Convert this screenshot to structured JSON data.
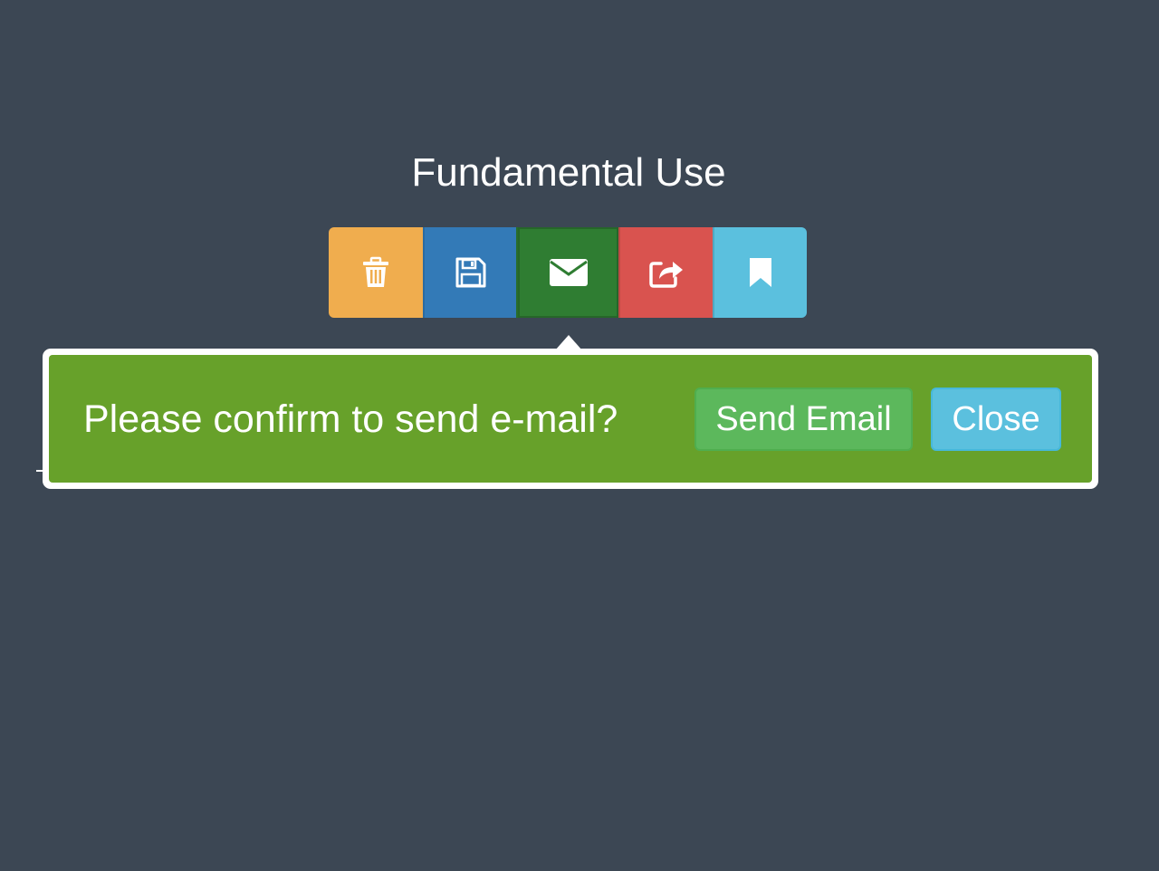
{
  "page": {
    "title": "Fundamental Use"
  },
  "toolbar": {
    "buttons": [
      {
        "id": "delete",
        "icon": "trash-icon",
        "color": "#f0ad4e"
      },
      {
        "id": "save",
        "icon": "floppy-disk-icon",
        "color": "#337ab7"
      },
      {
        "id": "email",
        "icon": "envelope-icon",
        "color": "#2f7d32",
        "active": true
      },
      {
        "id": "share",
        "icon": "share-icon",
        "color": "#d9534f"
      },
      {
        "id": "bookmark",
        "icon": "bookmark-icon",
        "color": "#5bc0de"
      }
    ]
  },
  "popover": {
    "message": "Please confirm to send e-mail?",
    "confirm_label": "Send Email",
    "close_label": "Close",
    "background": "#67a12a",
    "confirm_color": "#5cb85c",
    "close_color": "#5bc0de"
  }
}
